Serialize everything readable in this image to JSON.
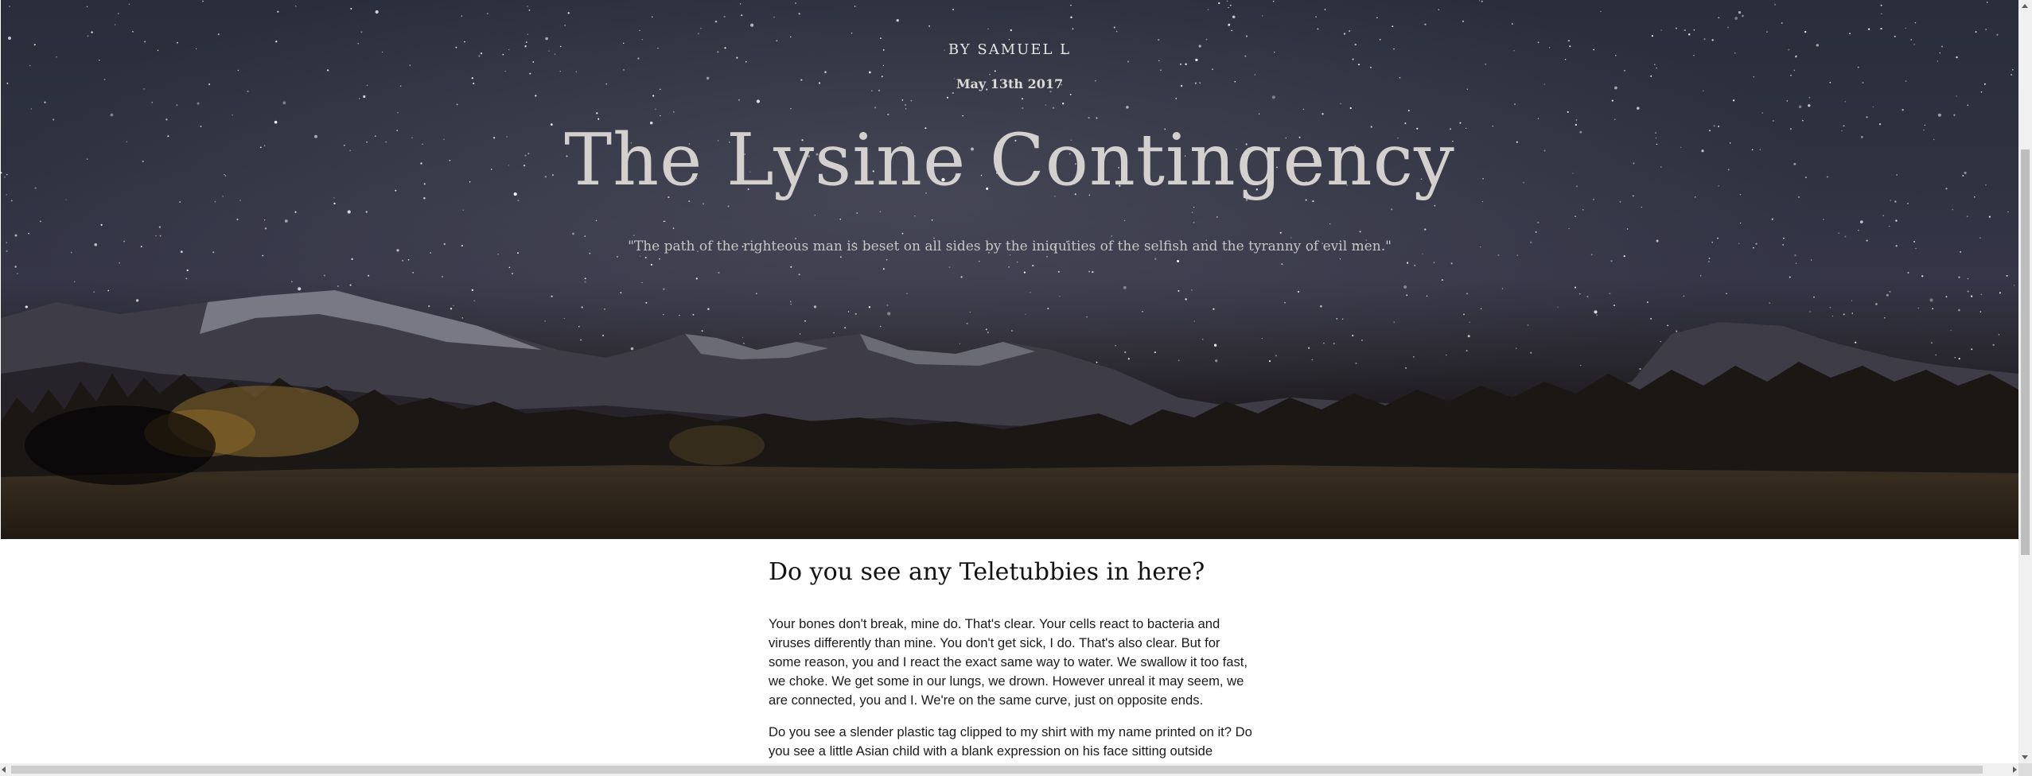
{
  "hero": {
    "byline": "BY SAMUEL L",
    "date": "May 13th 2017",
    "title": "The Lysine Contingency",
    "quote": "\"The path of the righteous man is beset on all sides by the iniquities of the selfish and the tyranny of evil men.\""
  },
  "article": {
    "heading": "Do you see any Teletubbies in here?",
    "paragraph1": "Your bones don't break, mine do. That's clear. Your cells react to bacteria and viruses differently than mine. You don't get sick, I do. That's also clear. But for some reason, you and I react the exact same way to water. We swallow it too fast, we choke. We get some in our lungs, we drown. However unreal it may seem, we are connected, you and I. We're on the same curve, just on opposite ends.",
    "paragraph2": "Do you see a slender plastic tag clipped to my shirt with my name printed on it? Do you see a little Asian child with a blank expression on his face sitting outside"
  },
  "colors": {
    "sky_top": "#2a2d3b",
    "ground": "#15120f",
    "title_text": "#d3d0ce",
    "body_text": "#1a1a1a"
  }
}
